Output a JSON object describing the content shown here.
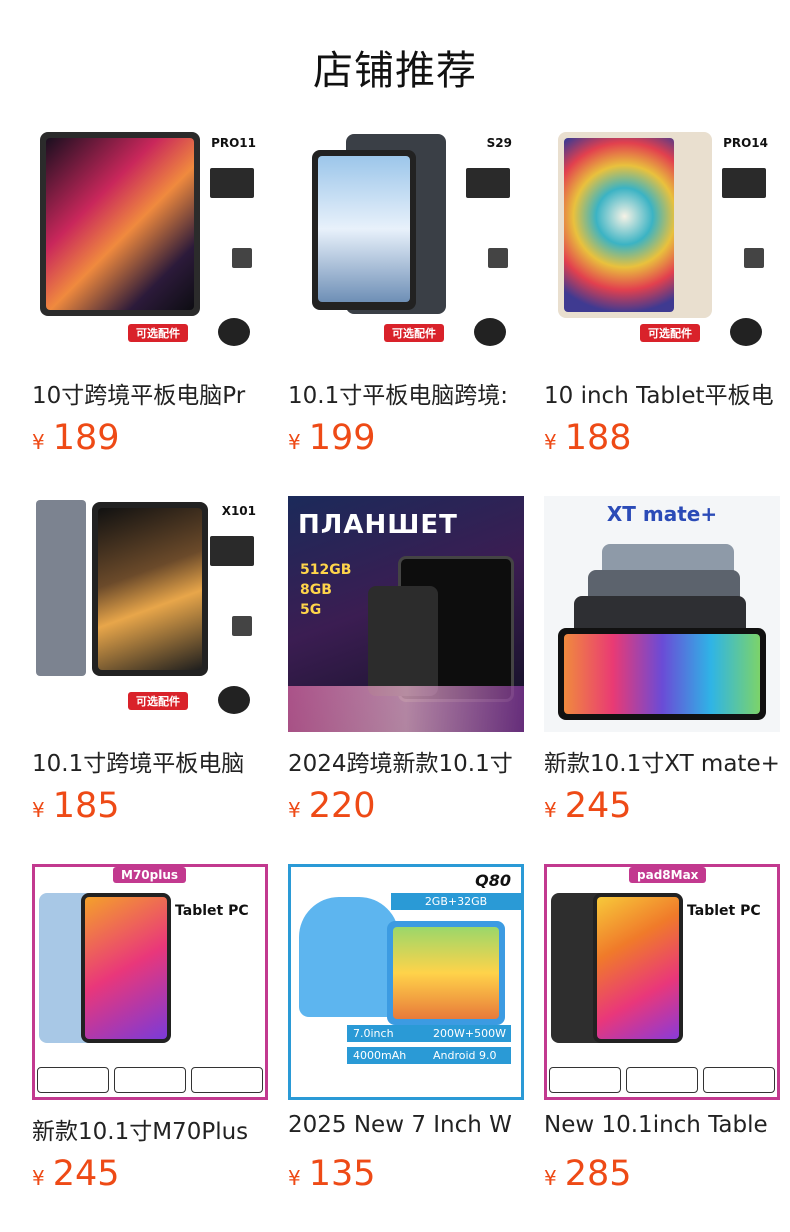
{
  "header": {
    "title": "店铺推荐"
  },
  "products": [
    {
      "name": "10寸跨境平板电脑Pr",
      "currency": "¥",
      "price": "189",
      "model_label": "PRO11"
    },
    {
      "name": "10.1寸平板电脑跨境:",
      "currency": "¥",
      "price": "199",
      "model_label": "S29"
    },
    {
      "name": "10 inch Tablet平板电",
      "currency": "¥",
      "price": "188",
      "model_label": "PRO14"
    },
    {
      "name": "10.1寸跨境平板电脑",
      "currency": "¥",
      "price": "185",
      "model_label": "X101"
    },
    {
      "name": "2024跨境新款10.1寸",
      "currency": "¥",
      "price": "220",
      "model_label": "ПЛАНШЕТ"
    },
    {
      "name": "新款10.1寸XT mate+",
      "currency": "¥",
      "price": "245",
      "model_label": "XT mate+"
    },
    {
      "name": "新款10.1寸M70Plus",
      "currency": "¥",
      "price": "245",
      "model_label": "M70plus"
    },
    {
      "name": "2025 New 7 Inch W",
      "currency": "¥",
      "price": "135",
      "model_label": "Q80"
    },
    {
      "name": "New 10.1inch Table",
      "currency": "¥",
      "price": "285",
      "model_label": "pad8Max"
    }
  ],
  "colors": {
    "price": "#ee4a16",
    "title": "#111111"
  }
}
